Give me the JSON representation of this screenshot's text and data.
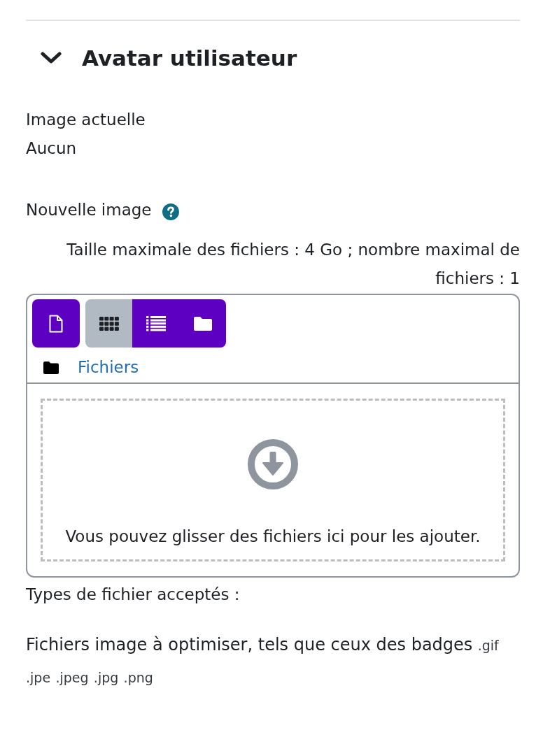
{
  "section": {
    "title": "Avatar utilisateur",
    "expanded": true
  },
  "current_image": {
    "label": "Image actuelle",
    "value": "Aucun"
  },
  "new_image": {
    "label": "Nouvelle image",
    "help_icon": true,
    "limits": "Taille maximale des fichiers : 4 Go ; nombre maximal de fichiers : 1"
  },
  "filepicker": {
    "view_buttons": [
      {
        "kind": "icons",
        "selected": true
      },
      {
        "kind": "list",
        "selected": false
      },
      {
        "kind": "tree",
        "selected": false
      }
    ],
    "path": "Fichiers",
    "dropzone_text": "Vous pouvez glisser des fichiers ici pour les ajouter."
  },
  "accepted_types": {
    "label": "Types de fichier acceptés :",
    "groups": [
      {
        "description": "Fichiers image à optimiser, tels que ceux des badges",
        "extensions": [
          ".gif",
          ".jpe",
          ".jpeg",
          ".jpg",
          ".png"
        ]
      }
    ]
  }
}
